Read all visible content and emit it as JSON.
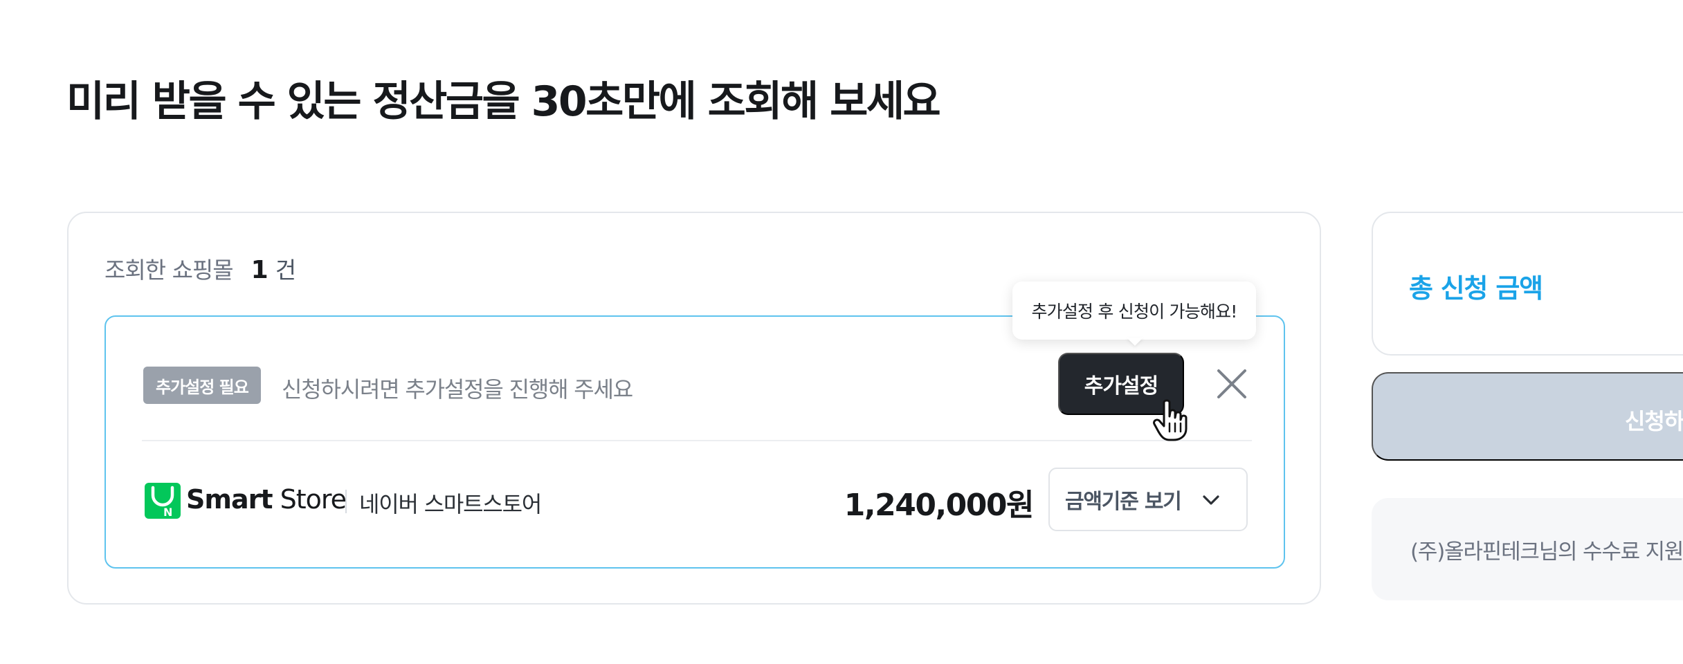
{
  "page": {
    "title": "미리 받을 수 있는 정산금을 30초만에 조회해 보세요"
  },
  "summary": {
    "label": "조회한 쇼핑몰",
    "count": "1",
    "unit": "건"
  },
  "mall": {
    "badge": "추가설정 필요",
    "notice": "신청하시려면 추가설정을 진행해 주세요",
    "setup_button": "추가설정",
    "tooltip": "추가설정 후 신청이 가능해요!",
    "brand_bold": "Smart",
    "brand_regular": "Store",
    "name": "네이버 스마트스토어",
    "amount": "1,240,000원",
    "sort_select": "금액기준 보기",
    "logo_icon": "naver-smartstore-icon"
  },
  "sidebar": {
    "total_label": "총 신청 금액",
    "apply_button": "신청하",
    "fee_notice": "(주)올라핀테크님의 수수료 지원"
  },
  "colors": {
    "accent": "#1aa3e8",
    "highlight_border": "#5ec3ee",
    "dark_button": "#23272d",
    "disabled_button": "#c9d3df",
    "badge_bg": "#9aa1ab",
    "brand_green": "#03c75a"
  }
}
